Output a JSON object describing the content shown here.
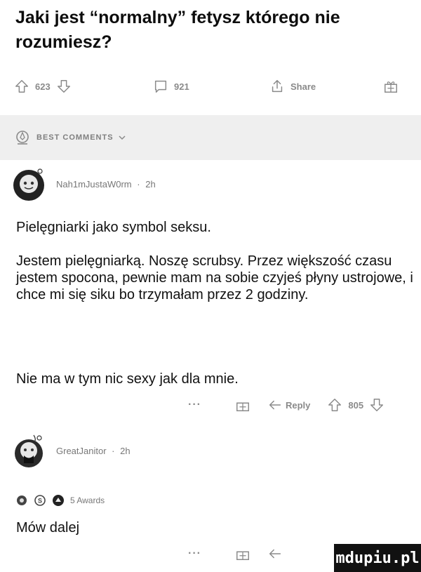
{
  "post": {
    "title": "Jaki jest “normalny” fetysz którego nie rozumiesz?"
  },
  "action_bar": {
    "upvotes": "623",
    "comments": "921",
    "share_label": "Share"
  },
  "sort": {
    "label": "BEST COMMENTS"
  },
  "comments": [
    {
      "author": "Nah1mJustaW0rm",
      "age": "2h",
      "paragraphs": [
        "Pielęgniarki jako symbol seksu.",
        "Jestem pielęgniarką. Noszę scrubsy. Przez większość czasu jestem spocona, pewnie mam na sobie czyjeś płyny ustrojowe, i chce mi się siku bo trzymałam przez 2 godziny.",
        "Nie ma w tym nic sexy jak dla mnie."
      ],
      "reply_label": "Reply",
      "score": "805"
    },
    {
      "author": "GreatJanitor",
      "age": "2h",
      "awards_label": "5 Awards",
      "paragraphs": [
        "Mów dalej"
      ]
    }
  ],
  "watermark": "mdupiu.pl",
  "icons": {
    "upvote": "upvote-icon",
    "downvote": "downvote-icon",
    "comment": "comment-bubble-icon",
    "share": "share-icon",
    "award": "gift-award-icon",
    "sort": "rocket-sort-icon",
    "reply": "reply-arrow-icon"
  }
}
